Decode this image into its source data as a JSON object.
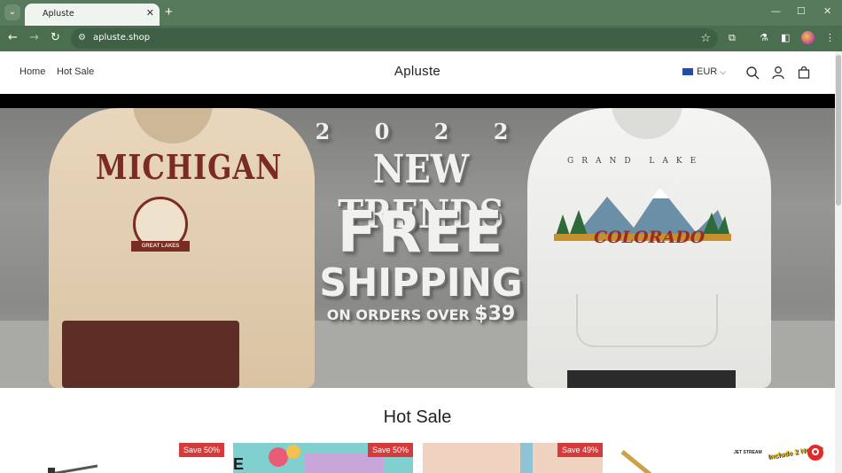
{
  "browser": {
    "tab_title": "Apluste",
    "tab_close": "✕",
    "new_tab": "+",
    "url": "apluste.shop",
    "window_controls": {
      "minimize": "—",
      "maximize": "☐",
      "close": "✕"
    },
    "icons": [
      "tab-search-icon",
      "back-icon",
      "forward-icon",
      "reload-icon",
      "site-info-icon",
      "bookmark-star-icon",
      "extensions-icon",
      "labs-icon",
      "side-panel-icon",
      "profile-avatar-icon",
      "menu-icon"
    ]
  },
  "header": {
    "nav": [
      "Home",
      "Hot Sale"
    ],
    "brand": "Apluste",
    "currency": "EUR"
  },
  "hero": {
    "line_year": "2 0 2 2",
    "line_trends": "NEW TRENDS",
    "line_free": "FREE",
    "line_shipping": "SHIPPING",
    "line_orders": "ON ORDERS OVER",
    "line_amount": "$39",
    "left_print": "MICHIGAN",
    "left_emblem": "GREAT LAKES",
    "right_print_top": "GRAND LAKE",
    "right_print": "COLORADO"
  },
  "section": {
    "title": "Hot Sale"
  },
  "products": [
    {
      "badge": "Save 50%"
    },
    {
      "badge": "Save 50%"
    },
    {
      "badge": "Save 49%"
    },
    {
      "badge": "",
      "label_a": "JET STREAM",
      "label_b": "Include 2 Nozzle"
    }
  ],
  "colors": {
    "chrome_tabbar": "#587a5c",
    "chrome_toolbar": "#4a6e4f",
    "sale_badge": "#d63a3a",
    "announcement_bar": "#000000"
  }
}
